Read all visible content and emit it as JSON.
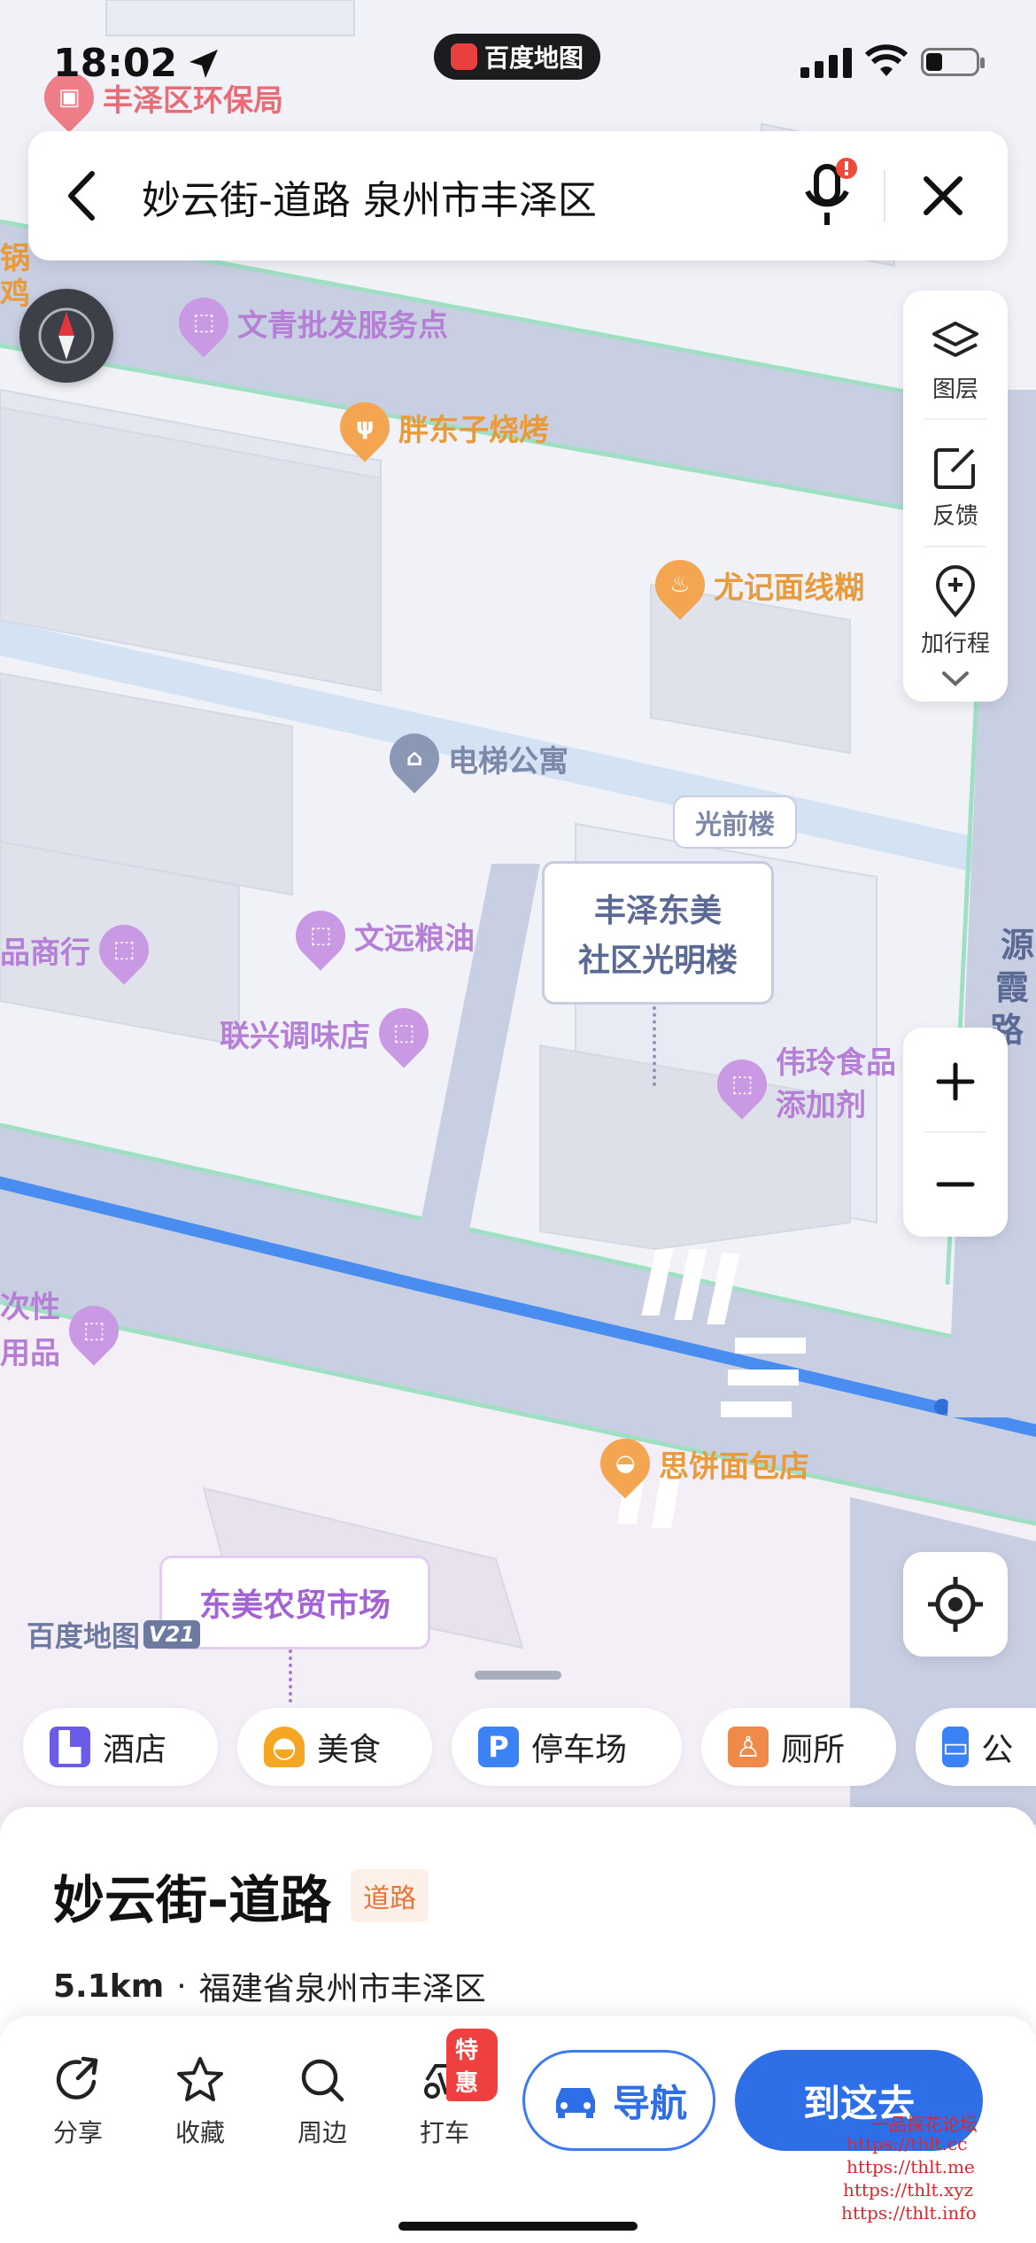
{
  "status_bar": {
    "time": "18:02",
    "app_pill": "百度地图"
  },
  "search": {
    "query": "妙云街-道路 泉州市丰泽区"
  },
  "map_tools": {
    "layers": "图层",
    "feedback": "反馈",
    "add_trip": "加行程"
  },
  "map": {
    "brand": "百度地图",
    "version": "V21",
    "pois": {
      "huanbao": "丰泽区环保局",
      "wenqing": "文青批发服务点",
      "pangdongzi": "胖东子烧烤",
      "youji": "尤记面线糊",
      "dianti": "电梯公寓",
      "guangqian": "光前楼",
      "wenyuan": "文远粮油",
      "lianxing": "联兴调味店",
      "weiling_1": "伟玲食品",
      "weiling_2": "添加剂",
      "sibing": "思饼面包店",
      "left_1": "品商行",
      "left_2": "次性",
      "left_3": "用品",
      "edge_1": "锅",
      "edge_2": "鸡"
    },
    "building_label_1": "丰泽东美",
    "building_label_2": "社区光明楼",
    "market_label": "东美农贸市场",
    "road_name": "源霞路"
  },
  "categories": [
    {
      "label": "酒店",
      "icon": "hotel-icon",
      "color": "#6b5ce7"
    },
    {
      "label": "美食",
      "icon": "food-icon",
      "color": "#f5a623"
    },
    {
      "label": "停车场",
      "icon": "parking-icon",
      "color": "#3b82f6"
    },
    {
      "label": "厕所",
      "icon": "toilet-icon",
      "color": "#f08a4b"
    },
    {
      "label": "公",
      "icon": "bus-icon",
      "color": "#3b82f6"
    }
  ],
  "place": {
    "name": "妙云街-道路",
    "tag": "道路",
    "distance": "5.1km",
    "separator": "·",
    "address": "福建省泉州市丰泽区"
  },
  "actions": {
    "share": "分享",
    "favorite": "收藏",
    "nearby": "周边",
    "taxi": "打车",
    "taxi_badge": "特惠",
    "navigate": "导航",
    "go_here": "到这去"
  },
  "watermark": {
    "line0": "一品探花论坛",
    "line1": "https://thlt.cc",
    "line2": "https://thlt.me",
    "line3": "https://thlt.xyz",
    "line4": "https://thlt.info"
  }
}
